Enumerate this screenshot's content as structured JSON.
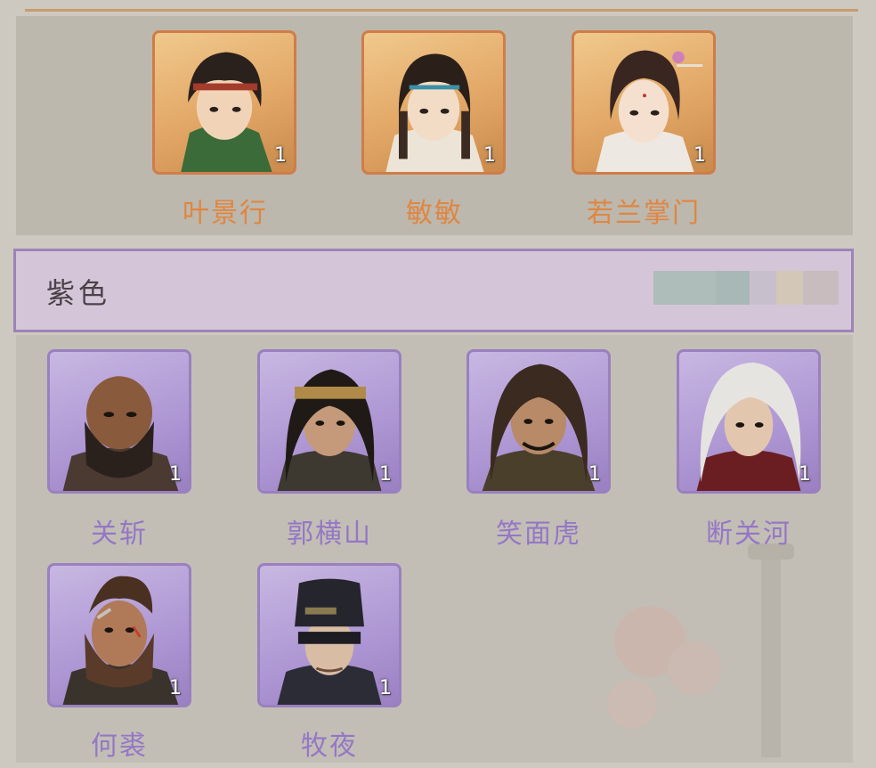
{
  "colors": {
    "gold_accent": "#e08640",
    "purple_accent": "#9577c6",
    "panel_bg": "#bcb8ae",
    "rarity_bar_bg": "#d4c6d8"
  },
  "gold_heroes": [
    {
      "name": "叶景行",
      "count": "1",
      "icon": "portrait-young-swordsman-headband"
    },
    {
      "name": "敏敏",
      "count": "1",
      "icon": "portrait-girl-braided-hair"
    },
    {
      "name": "若兰掌门",
      "count": "1",
      "icon": "portrait-woman-hairpin"
    }
  ],
  "rarity": {
    "label": "紫色"
  },
  "purple_heroes": [
    {
      "name": "关斩",
      "count": "1",
      "icon": "portrait-bald-bearded-warrior"
    },
    {
      "name": "郭横山",
      "count": "1",
      "icon": "portrait-headband-long-hair-man"
    },
    {
      "name": "笑面虎",
      "count": "1",
      "icon": "portrait-grinning-scarred-man"
    },
    {
      "name": "断关河",
      "count": "1",
      "icon": "portrait-white-haired-swordsman"
    },
    {
      "name": "何裘",
      "count": "1",
      "icon": "portrait-bearded-scarred-fighter"
    },
    {
      "name": "牧夜",
      "count": "1",
      "icon": "portrait-masked-hat-man"
    }
  ]
}
